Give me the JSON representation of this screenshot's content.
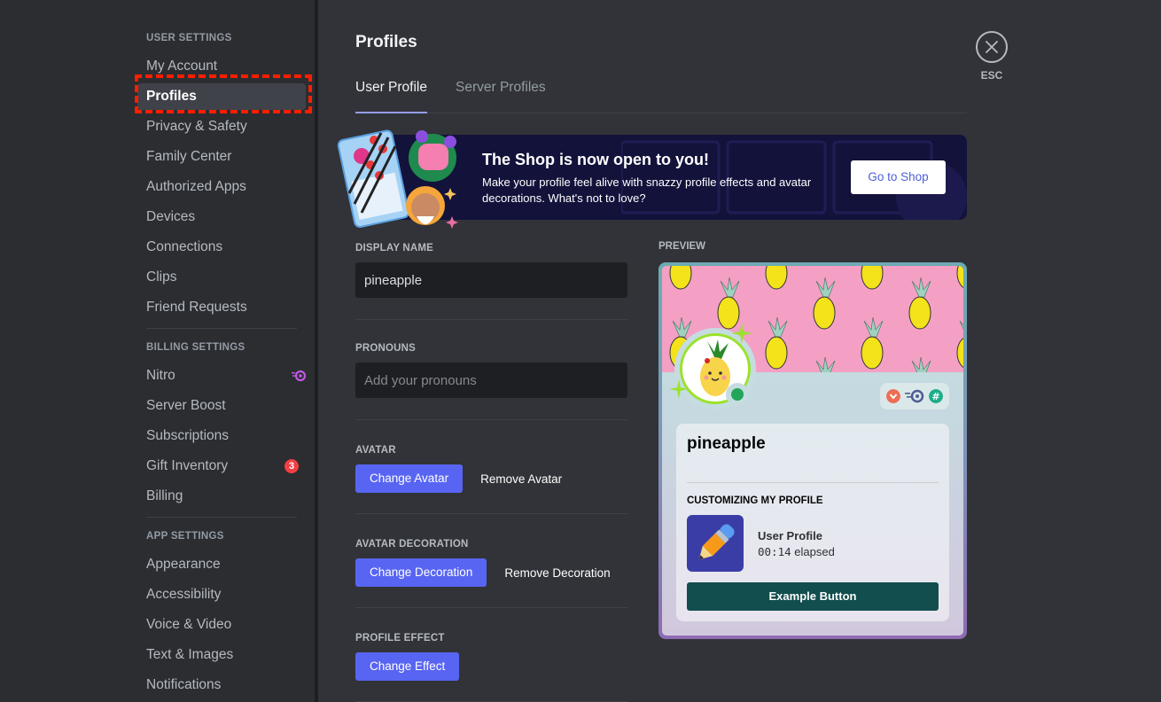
{
  "sidebar": {
    "sections": [
      {
        "header": "USER SETTINGS",
        "items": [
          {
            "label": "My Account"
          },
          {
            "label": "Profiles",
            "active": true
          },
          {
            "label": "Privacy & Safety"
          },
          {
            "label": "Family Center"
          },
          {
            "label": "Authorized Apps"
          },
          {
            "label": "Devices"
          },
          {
            "label": "Connections"
          },
          {
            "label": "Clips"
          },
          {
            "label": "Friend Requests"
          }
        ]
      },
      {
        "header": "BILLING SETTINGS",
        "items": [
          {
            "label": "Nitro",
            "icon": "nitro-icon"
          },
          {
            "label": "Server Boost"
          },
          {
            "label": "Subscriptions"
          },
          {
            "label": "Gift Inventory",
            "badge": "3"
          },
          {
            "label": "Billing"
          }
        ]
      },
      {
        "header": "APP SETTINGS",
        "items": [
          {
            "label": "Appearance"
          },
          {
            "label": "Accessibility"
          },
          {
            "label": "Voice & Video"
          },
          {
            "label": "Text & Images"
          },
          {
            "label": "Notifications"
          }
        ]
      }
    ]
  },
  "header": {
    "title": "Profiles",
    "tabs": [
      {
        "label": "User Profile",
        "active": true
      },
      {
        "label": "Server Profiles",
        "active": false
      }
    ],
    "close_label": "ESC"
  },
  "shop_banner": {
    "title": "The Shop is now open to you!",
    "text": "Make your profile feel alive with snazzy profile effects and avatar decorations. What's not to love?",
    "button_label": "Go to Shop"
  },
  "form": {
    "display_name": {
      "label": "DISPLAY NAME",
      "value": "pineapple"
    },
    "pronouns": {
      "label": "PRONOUNS",
      "value": "",
      "placeholder": "Add your pronouns"
    },
    "avatar": {
      "label": "AVATAR",
      "primary": "Change Avatar",
      "secondary": "Remove Avatar"
    },
    "avatar_decoration": {
      "label": "AVATAR DECORATION",
      "primary": "Change Decoration",
      "secondary": "Remove Decoration"
    },
    "profile_effect": {
      "label": "PROFILE EFFECT",
      "primary": "Change Effect"
    }
  },
  "preview": {
    "label": "PREVIEW",
    "name": "pineapple",
    "status": "online",
    "badges": [
      "hypesquad-icon",
      "nitro-icon",
      "hashtag-icon"
    ],
    "activity_heading": "CUSTOMIZING MY PROFILE",
    "activity_title": "User Profile",
    "activity_time": "00:14",
    "activity_time_suffix": "elapsed",
    "example_button": "Example Button"
  },
  "colors": {
    "accent": "#5865f2",
    "highlight": "#ff1e00",
    "example_button": "#124e4e",
    "status_online": "#23a55a"
  }
}
